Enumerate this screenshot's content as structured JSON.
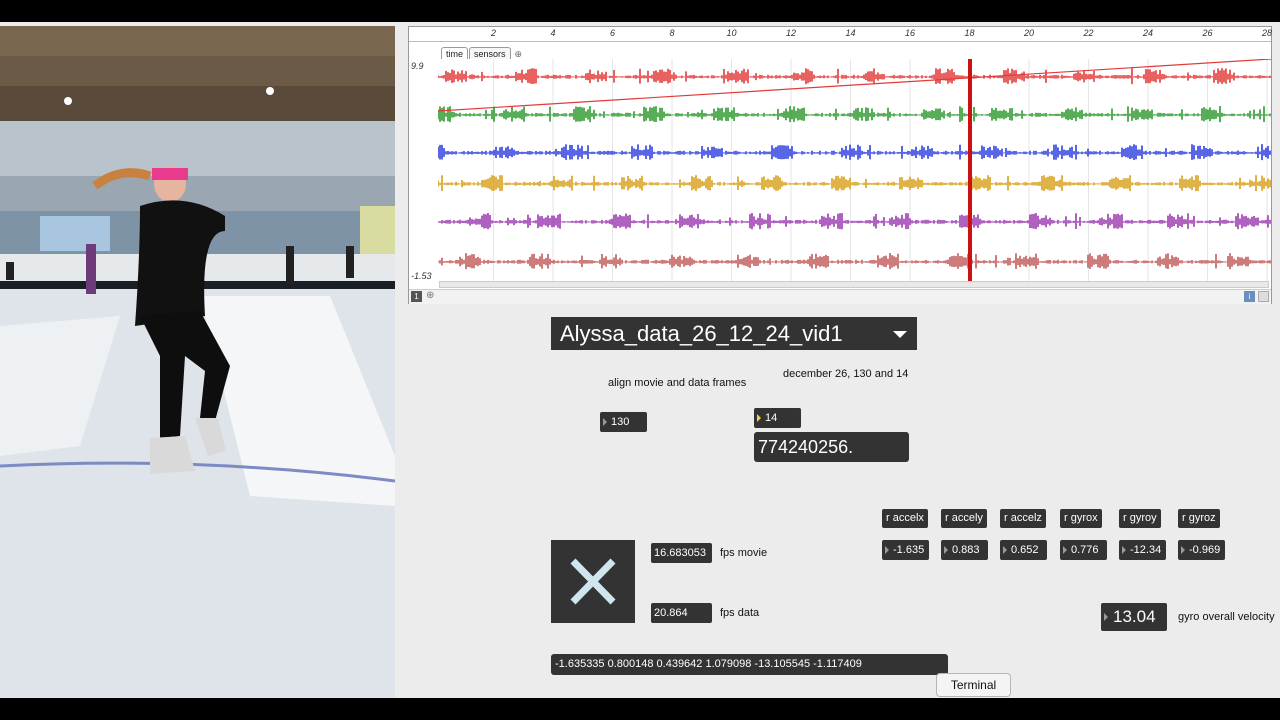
{
  "ruler": {
    "ticks": [
      "2",
      "4",
      "6",
      "8",
      "10",
      "12",
      "14",
      "16",
      "18",
      "20",
      "22",
      "24",
      "26",
      "28"
    ]
  },
  "plot": {
    "tabs": [
      "time",
      "sensors"
    ],
    "y_max_label": "9.9",
    "y_min_label": "-1.53",
    "footer_index": "1",
    "info_label": "i",
    "trace_colors": [
      "#e33a3a",
      "#2e9a2e",
      "#2f3fe0",
      "#d9a01a",
      "#9d3ab0",
      "#c25a5a"
    ],
    "cursor_color": "#cc1111"
  },
  "menu": {
    "selected": "Alyssa_data_26_12_24_vid1"
  },
  "labels": {
    "align": "align movie and data frames",
    "date_note": "december 26, 130 and 14",
    "fps_movie": "fps movie",
    "fps_data": "fps data",
    "gyro_overall": "gyro overall velocity"
  },
  "numbers": {
    "offset_a": "130",
    "offset_b": "14",
    "timestamp": "774240256.",
    "fps_movie": "16.683053",
    "fps_data": "20.864",
    "gyro_overall": "13.04"
  },
  "receivers": [
    {
      "name": "r accelx",
      "value": "-1.635"
    },
    {
      "name": "r accely",
      "value": "0.883"
    },
    {
      "name": "r accelz",
      "value": "0.652"
    },
    {
      "name": "r gyrox",
      "value": "0.776"
    },
    {
      "name": "r gyroy",
      "value": "-12.34"
    },
    {
      "name": "r gyroz",
      "value": "-0.969"
    }
  ],
  "message": "-1.635335 0.800148 0.439642 1.079098 -13.105545 -1.117409",
  "terminal_button": "Terminal"
}
